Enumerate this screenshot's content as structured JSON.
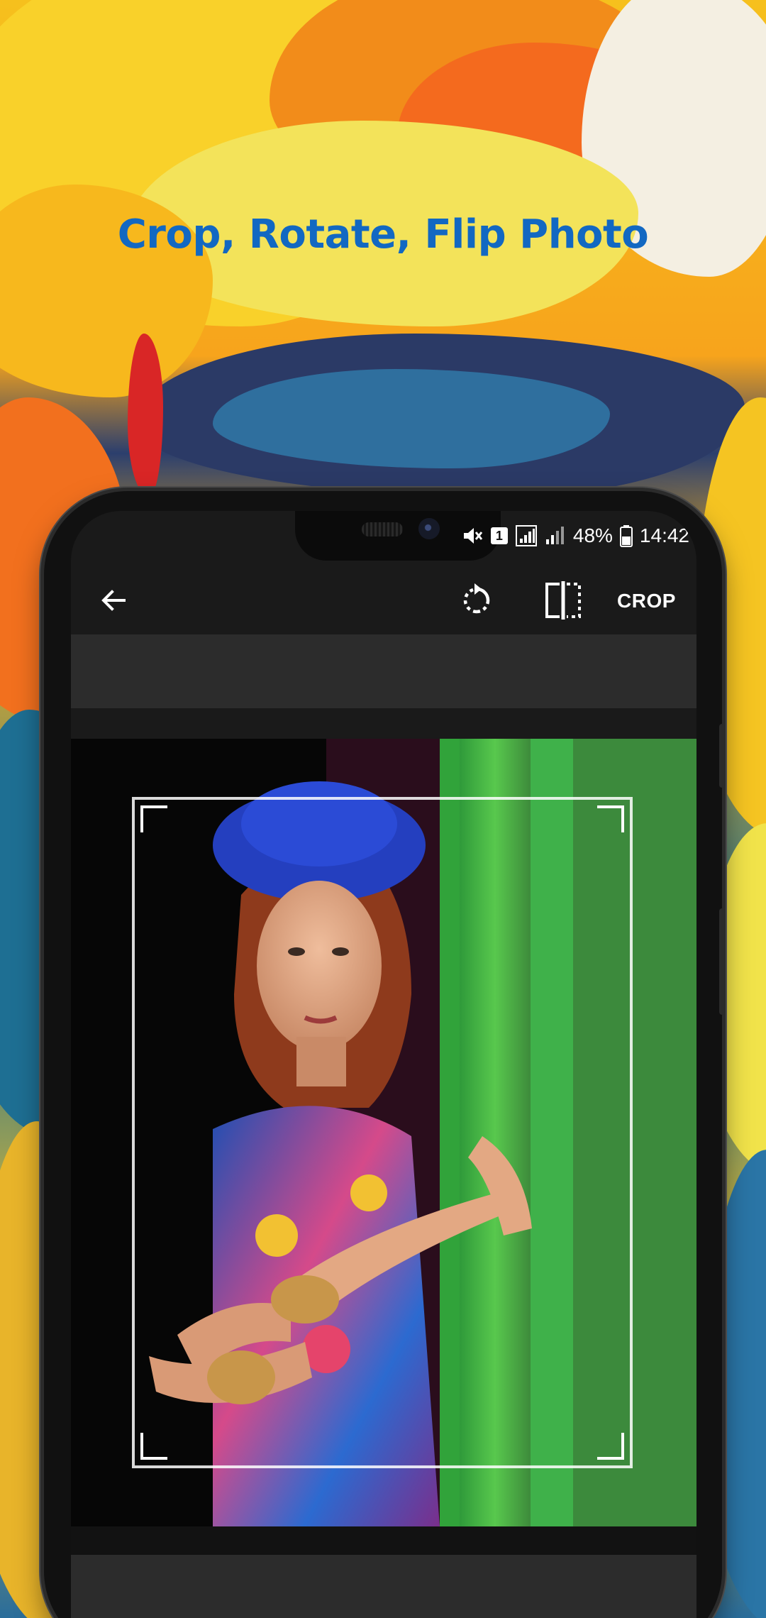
{
  "promo": {
    "headline": "Crop, Rotate, Flip Photo"
  },
  "status_bar": {
    "sim_slot": "1",
    "battery": "48%",
    "time": "14:42",
    "icons": [
      "mute-icon",
      "sim-1-icon",
      "signal-icon",
      "signal-icon",
      "battery-icon"
    ]
  },
  "toolbar": {
    "back_icon": "arrow-left-icon",
    "rotate_icon": "rotate-icon",
    "flip_icon": "flip-horizontal-icon",
    "crop_label": "CROP"
  },
  "colors": {
    "headline": "#1268c2",
    "toolbar_bg": "#1a1a1a",
    "panel_bg": "#2c2c2c",
    "crop_frame": "#ffffff"
  }
}
